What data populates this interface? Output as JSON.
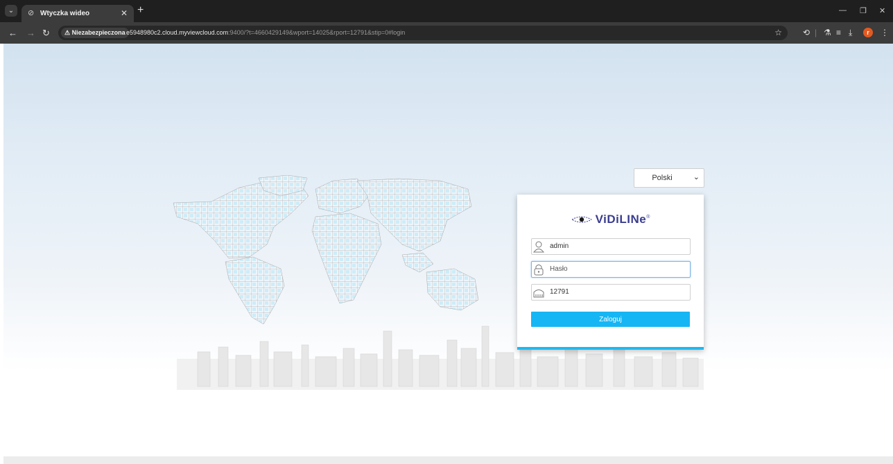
{
  "browser": {
    "tab_title": "Wtyczka wideo",
    "new_tab": "+",
    "security_label": "Niezabezpieczona",
    "url_host": "e5948980c2.cloud.myviewcloud.com",
    "url_rest": ":9400/?t=4660429149&wport=14025&rport=12791&stip=0#login"
  },
  "login": {
    "language": "Polski",
    "brand": "ViDiLINe",
    "brand_mark": "®",
    "username_value": "admin",
    "password_placeholder": "Hasło",
    "port_value": "12791",
    "submit_label": "Zaloguj"
  },
  "colors": {
    "accent": "#16b6f4",
    "brand": "#3a3d8f"
  }
}
